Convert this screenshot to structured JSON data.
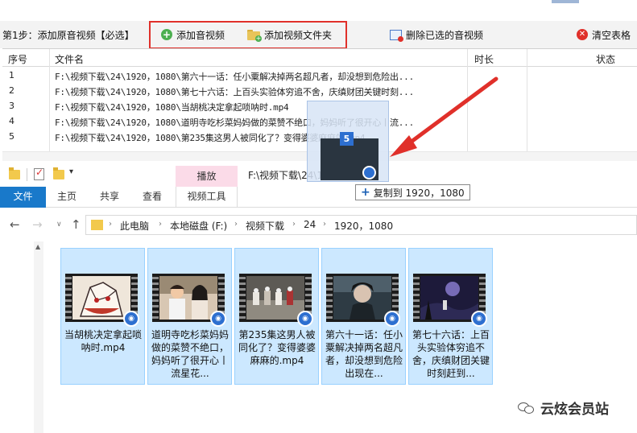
{
  "app": {
    "step_label": "第1步：添加原音视频【必选】",
    "buttons": {
      "add_audio": "添加音视频",
      "add_folder": "添加视频文件夹",
      "delete_selected": "删除已选的音视频",
      "clear_table": "清空表格"
    },
    "columns": {
      "index": "序号",
      "filename": "文件名",
      "duration": "时长",
      "status": "状态"
    },
    "rows": [
      {
        "index": "1",
        "filename": "F:\\视频下载\\24\\1920，1080\\第六十一话：任小粟解决掉两名超凡者，却没想到危险出..."
      },
      {
        "index": "2",
        "filename": "F:\\视频下载\\24\\1920，1080\\第七十六话：上百头实验体穷追不舍，庆缜财团关键时刻..."
      },
      {
        "index": "3",
        "filename": "F:\\视频下载\\24\\1920，1080\\当胡桃决定拿起唢呐时.mp4"
      },
      {
        "index": "4",
        "filename": "F:\\视频下载\\24\\1920，1080\\道明寺吃杉菜妈妈做的菜赞不绝口，妈妈听了很开心丨流..."
      },
      {
        "index": "5",
        "filename": "F:\\视频下载\\24\\1920，1080\\第235集这男人被同化了？变得婆婆麻麻的.mp4"
      }
    ]
  },
  "explorer": {
    "context_tab": "播放",
    "title_path": "F:\\视频下载\\24\\1920，1080",
    "ribbon_tabs": {
      "file": "文件",
      "home": "主页",
      "share": "共享",
      "view": "查看",
      "video_tools": "视频工具"
    },
    "breadcrumb": [
      "此电脑",
      "本地磁盘 (F:)",
      "视频下载",
      "24",
      "1920，1080"
    ],
    "files": [
      {
        "caption": "当胡桃决定拿起唢呐时.mp4"
      },
      {
        "caption": "道明寺吃杉菜妈妈做的菜赞不绝口，妈妈听了很开心丨流星花..."
      },
      {
        "caption": "第235集这男人被同化了？变得婆婆麻麻的.mp4"
      },
      {
        "caption": "第六十一话：任小粟解决掉两名超凡者，却没想到危险出现在..."
      },
      {
        "caption": "第七十六话：上百头实验体穷追不舍，庆缜财团关键时刻赶到..."
      }
    ],
    "drag_count": "5",
    "drop_tooltip": "复制到 1920，1080"
  },
  "watermark": {
    "text": "云炫会员站"
  },
  "colors": {
    "highlight_red": "#e0302a",
    "ribbon_blue": "#1979ca",
    "tile_selected": "#cce8ff",
    "context_tab_pink": "#fbdbe8"
  }
}
